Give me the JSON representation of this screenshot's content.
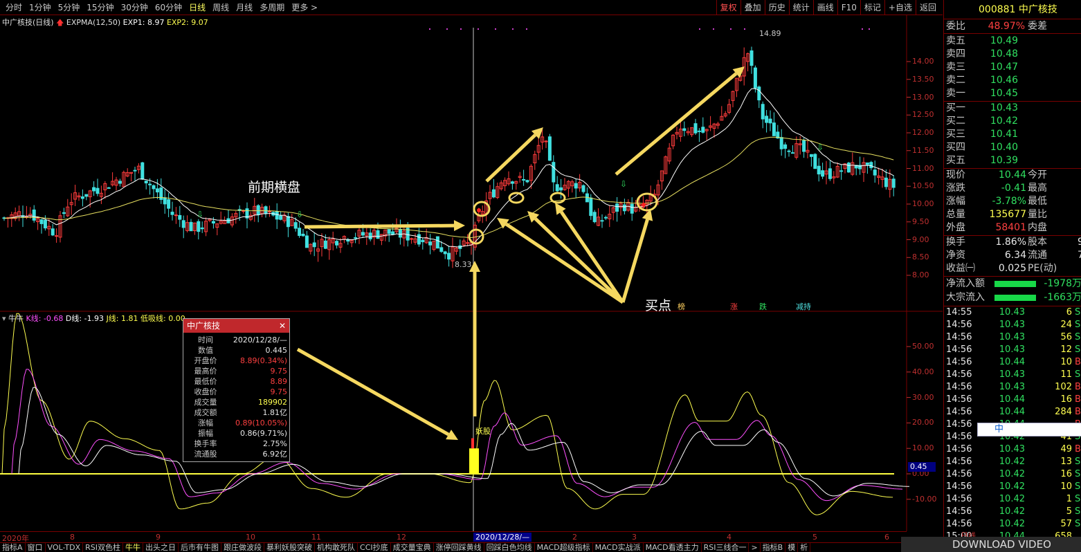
{
  "topbar": {
    "timeframes": [
      "分时",
      "1分钟",
      "5分钟",
      "15分钟",
      "30分钟",
      "60分钟",
      "日线",
      "周线",
      "月线",
      "多周期",
      "更多 >"
    ],
    "active": "日线",
    "right": [
      "复权",
      "叠加",
      "历史",
      "统计",
      "画线",
      "F10",
      "标记",
      "+自选",
      "返回"
    ]
  },
  "main_chart": {
    "title": "中广核技(日线)",
    "indicator": "EXPMA(12,50)",
    "exp1_label": "EXP1: 8.97",
    "exp2_label": "EXP2: 9.07",
    "y_ticks": [
      "14.00",
      "13.50",
      "13.00",
      "12.50",
      "12.00",
      "11.50",
      "11.00",
      "10.50",
      "10.00",
      "9.50",
      "9.00",
      "8.50",
      "8.00"
    ],
    "high_label": "14.89",
    "low_label": "8.33",
    "annotation_consolidation": "前期横盘",
    "annotation_buy": "买点",
    "marks": [
      "榜",
      "涨",
      "跌",
      "减持"
    ]
  },
  "sub_chart": {
    "name": "牛牛",
    "k_label": "K线: -0.68",
    "d_label": "D线: -1.93",
    "j_label": "J线: 1.81",
    "low_label": "低吸线: 0.00",
    "y_ticks": [
      "50.00",
      "40.00",
      "30.00",
      "20.00",
      "10.00",
      "0.00",
      "-10.00"
    ],
    "current_value": "0.45",
    "signal_label": "妖股"
  },
  "date_axis": [
    "2020年",
    "8",
    "9",
    "10",
    "11",
    "12",
    "2020/12/28/—",
    "2",
    "3",
    "4",
    "5",
    "6"
  ],
  "infobox": {
    "title": "中广核技",
    "rows": [
      {
        "k": "时间",
        "v": "2020/12/28/—",
        "c": "white"
      },
      {
        "k": "数值",
        "v": "0.445",
        "c": "white"
      },
      {
        "k": "开盘价",
        "v": "8.89(0.34%)",
        "c": "red"
      },
      {
        "k": "最高价",
        "v": "9.75",
        "c": "red"
      },
      {
        "k": "最低价",
        "v": "8.89",
        "c": "red"
      },
      {
        "k": "收盘价",
        "v": "9.75",
        "c": "red"
      },
      {
        "k": "成交量",
        "v": "189902",
        "c": "yellow"
      },
      {
        "k": "成交额",
        "v": "1.81亿",
        "c": "white"
      },
      {
        "k": "涨幅",
        "v": "0.89(10.05%)",
        "c": "red"
      },
      {
        "k": "振幅",
        "v": "0.86(9.71%)",
        "c": "white"
      },
      {
        "k": "换手率",
        "v": "2.75%",
        "c": "white"
      },
      {
        "k": "流通股",
        "v": "6.92亿",
        "c": "white"
      }
    ]
  },
  "sidebar": {
    "code": "000881",
    "name": "中广核技",
    "weibi_label": "委比",
    "weibi_value": "48.97%",
    "weicha_label": "委差",
    "sells": [
      {
        "label": "卖五",
        "price": "10.49"
      },
      {
        "label": "卖四",
        "price": "10.48"
      },
      {
        "label": "卖三",
        "price": "10.47"
      },
      {
        "label": "卖二",
        "price": "10.46"
      },
      {
        "label": "卖一",
        "price": "10.45"
      }
    ],
    "buys": [
      {
        "label": "买一",
        "price": "10.43"
      },
      {
        "label": "买二",
        "price": "10.42"
      },
      {
        "label": "买三",
        "price": "10.41"
      },
      {
        "label": "买四",
        "price": "10.40"
      },
      {
        "label": "买五",
        "price": "10.39"
      }
    ],
    "quote": [
      {
        "k": "现价",
        "v": "10.44",
        "c": "green",
        "k2": "今开"
      },
      {
        "k": "涨跌",
        "v": "-0.41",
        "c": "green",
        "k2": "最高"
      },
      {
        "k": "涨幅",
        "v": "-3.78%",
        "c": "green",
        "k2": "最低"
      },
      {
        "k": "总量",
        "v": "135677",
        "c": "yellow",
        "k2": "量比"
      },
      {
        "k": "外盘",
        "v": "58401",
        "c": "red",
        "k2": "内盘"
      }
    ],
    "stats": [
      {
        "k": "换手",
        "v": "1.86%",
        "k2": "股本",
        "v2": "9"
      },
      {
        "k": "净资",
        "v": "6.34",
        "k2": "流通",
        "v2": "7"
      },
      {
        "k": "收益㈠",
        "v": "0.025",
        "k2": "PE(动)",
        "v2": ""
      }
    ],
    "flows": [
      {
        "k": "净流入额",
        "v": "-1978万"
      },
      {
        "k": "大宗流入",
        "v": "-1663万"
      }
    ],
    "ticks": [
      {
        "t": "14:55",
        "p": "10.43",
        "q": "6",
        "s": "S"
      },
      {
        "t": "14:56",
        "p": "10.43",
        "q": "24",
        "s": "S"
      },
      {
        "t": "14:56",
        "p": "10.43",
        "q": "56",
        "s": "S"
      },
      {
        "t": "14:56",
        "p": "10.43",
        "q": "12",
        "s": "S"
      },
      {
        "t": "14:56",
        "p": "10.44",
        "q": "10",
        "s": "B"
      },
      {
        "t": "14:56",
        "p": "10.43",
        "q": "11",
        "s": "S"
      },
      {
        "t": "14:56",
        "p": "10.43",
        "q": "102",
        "s": "B"
      },
      {
        "t": "14:56",
        "p": "10.44",
        "q": "16",
        "s": "B"
      },
      {
        "t": "14:56",
        "p": "10.44",
        "q": "284",
        "s": "B"
      },
      {
        "t": "14:56",
        "p": "10.44",
        "q": "",
        "s": "B"
      },
      {
        "t": "14:56",
        "p": "10.42",
        "q": "41",
        "s": "S"
      },
      {
        "t": "14:56",
        "p": "10.43",
        "q": "49",
        "s": "B"
      },
      {
        "t": "14:56",
        "p": "10.42",
        "q": "13",
        "s": "S"
      },
      {
        "t": "14:56",
        "p": "10.42",
        "q": "16",
        "s": "S"
      },
      {
        "t": "14:56",
        "p": "10.42",
        "q": "10",
        "s": "S"
      },
      {
        "t": "14:56",
        "p": "10.42",
        "q": "1",
        "s": "S"
      },
      {
        "t": "14:56",
        "p": "10.42",
        "q": "5",
        "s": "S"
      },
      {
        "t": "14:56",
        "p": "10.42",
        "q": "57",
        "s": "S"
      },
      {
        "t": "15:00",
        "p": "10.44",
        "q": "658",
        "s": ""
      }
    ],
    "bottom_tab": "日线",
    "ime_label": "中"
  },
  "bottom_tabs": [
    "指标A",
    "窗口",
    "VOL-TDX",
    "RSI双色柱",
    "牛牛",
    "出头之日",
    "后市有牛图",
    "跟庄做波段",
    "暴利妖股突破",
    "机构敢死队",
    "CCI抄底",
    "成交量宝典",
    "涨停回踩黄线",
    "回踩白色均线",
    "MACD超级指标",
    "MACD实战派",
    "MACD看透主力",
    "RSI三线合一",
    ">",
    "指标B",
    "模",
    "析"
  ],
  "active_bottom_tab": "牛牛",
  "watermark": "DOWNLOAD VIDEO",
  "colors": {
    "up": "#ff3c3c",
    "down": "#40e0e0",
    "frame": "#7a0000",
    "ema1": "#ffffff",
    "ema2": "#e8e060",
    "arrow": "#f5d860"
  }
}
